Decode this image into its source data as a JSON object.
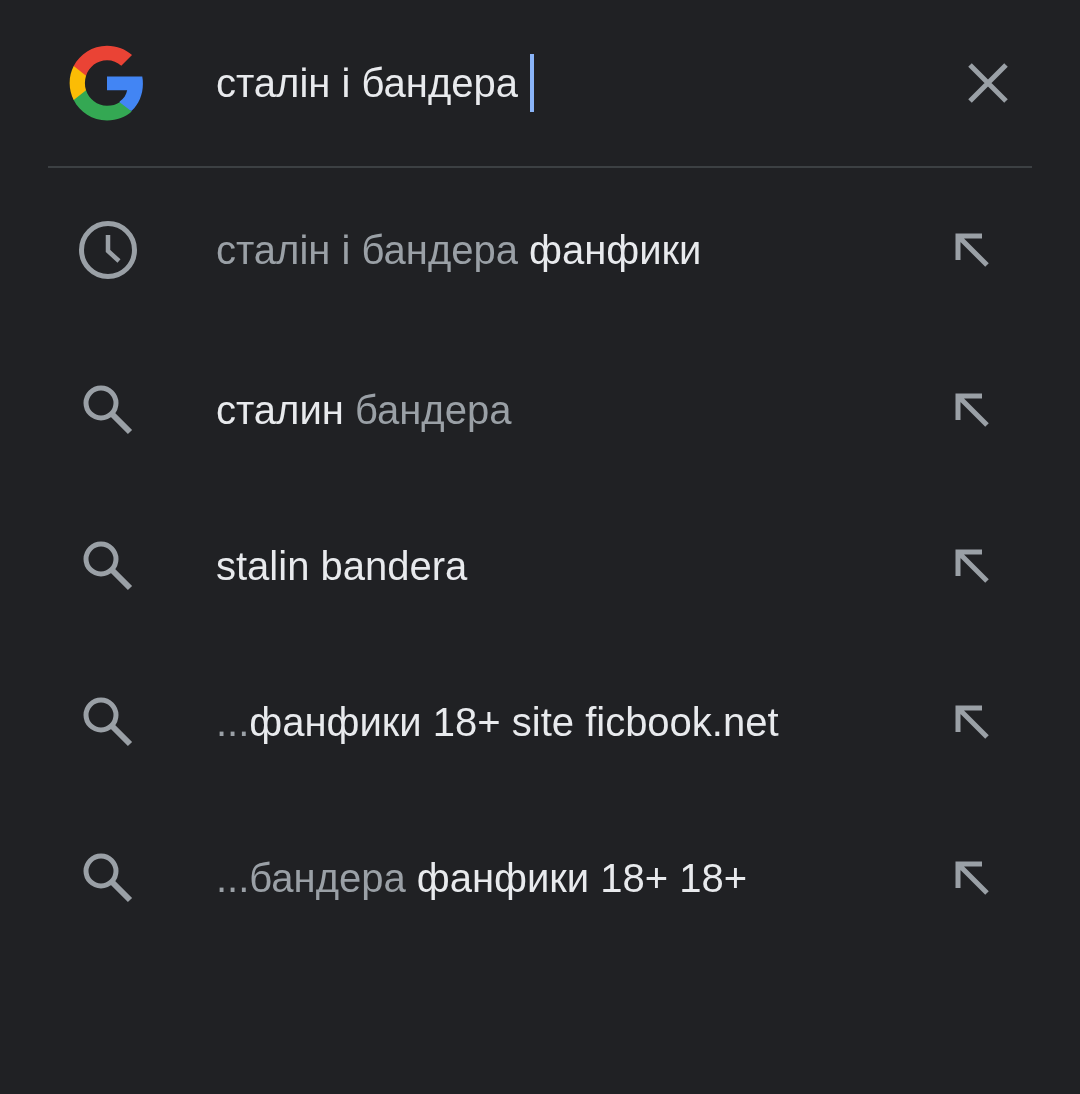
{
  "search": {
    "value": "сталін і бандера"
  },
  "suggestions": [
    {
      "kind": "history",
      "parts": [
        {
          "text": "сталін і бандера ",
          "kind": "typed"
        },
        {
          "text": "фанфики",
          "kind": "completion"
        }
      ]
    },
    {
      "kind": "search",
      "parts": [
        {
          "text": "сталин ",
          "kind": "completion"
        },
        {
          "text": "бандера",
          "kind": "typed"
        }
      ]
    },
    {
      "kind": "search",
      "parts": [
        {
          "text": "stalin bandera",
          "kind": "completion"
        }
      ]
    },
    {
      "kind": "search",
      "parts": [
        {
          "text": "...",
          "kind": "typed"
        },
        {
          "text": "фанфики 18+ site ficbook.net",
          "kind": "completion"
        }
      ]
    },
    {
      "kind": "search",
      "parts": [
        {
          "text": "...бандера ",
          "kind": "typed"
        },
        {
          "text": "фанфики 18+ 18+",
          "kind": "completion"
        }
      ]
    }
  ]
}
